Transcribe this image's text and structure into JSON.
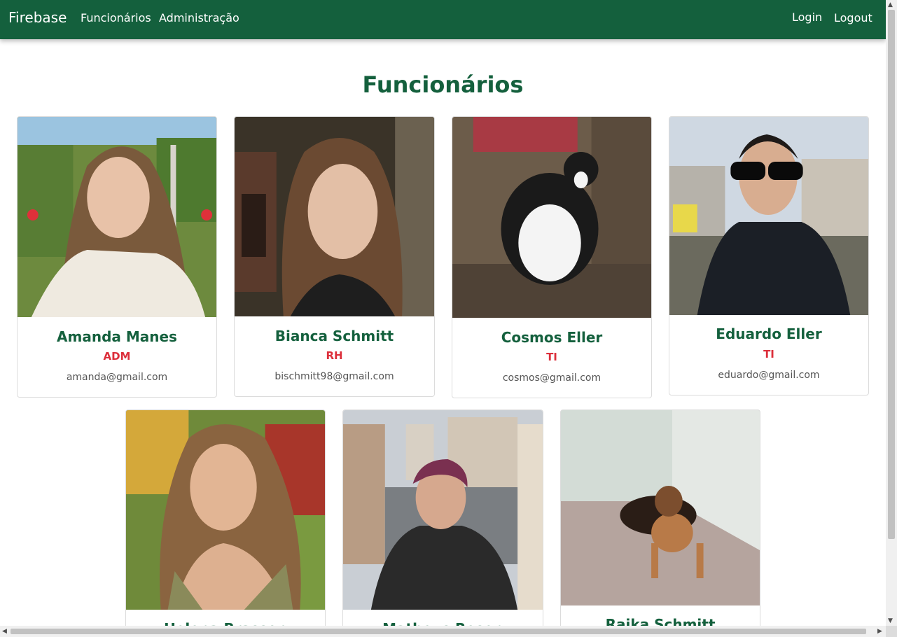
{
  "navbar": {
    "brand": "Firebase",
    "links": [
      "Funcionários",
      "Administração"
    ],
    "login": "Login",
    "logout": "Logout",
    "color": "#14603d"
  },
  "page_title": "Funcionários",
  "employees": [
    {
      "name": "Amanda Manes",
      "role": "ADM",
      "email": "amanda@gmail.com"
    },
    {
      "name": "Bianca Schmitt",
      "role": "RH",
      "email": "bischmitt98@gmail.com"
    },
    {
      "name": "Cosmos Eller",
      "role": "TI",
      "email": "cosmos@gmail.com"
    },
    {
      "name": "Eduardo Eller",
      "role": "TI",
      "email": "eduardo@gmail.com"
    },
    {
      "name": "Helena Brasson"
    },
    {
      "name": "Matheus Rosen"
    },
    {
      "name": "Raika Schmitt"
    }
  ],
  "colors": {
    "accent": "#14603d",
    "role": "#dc2f3b"
  }
}
